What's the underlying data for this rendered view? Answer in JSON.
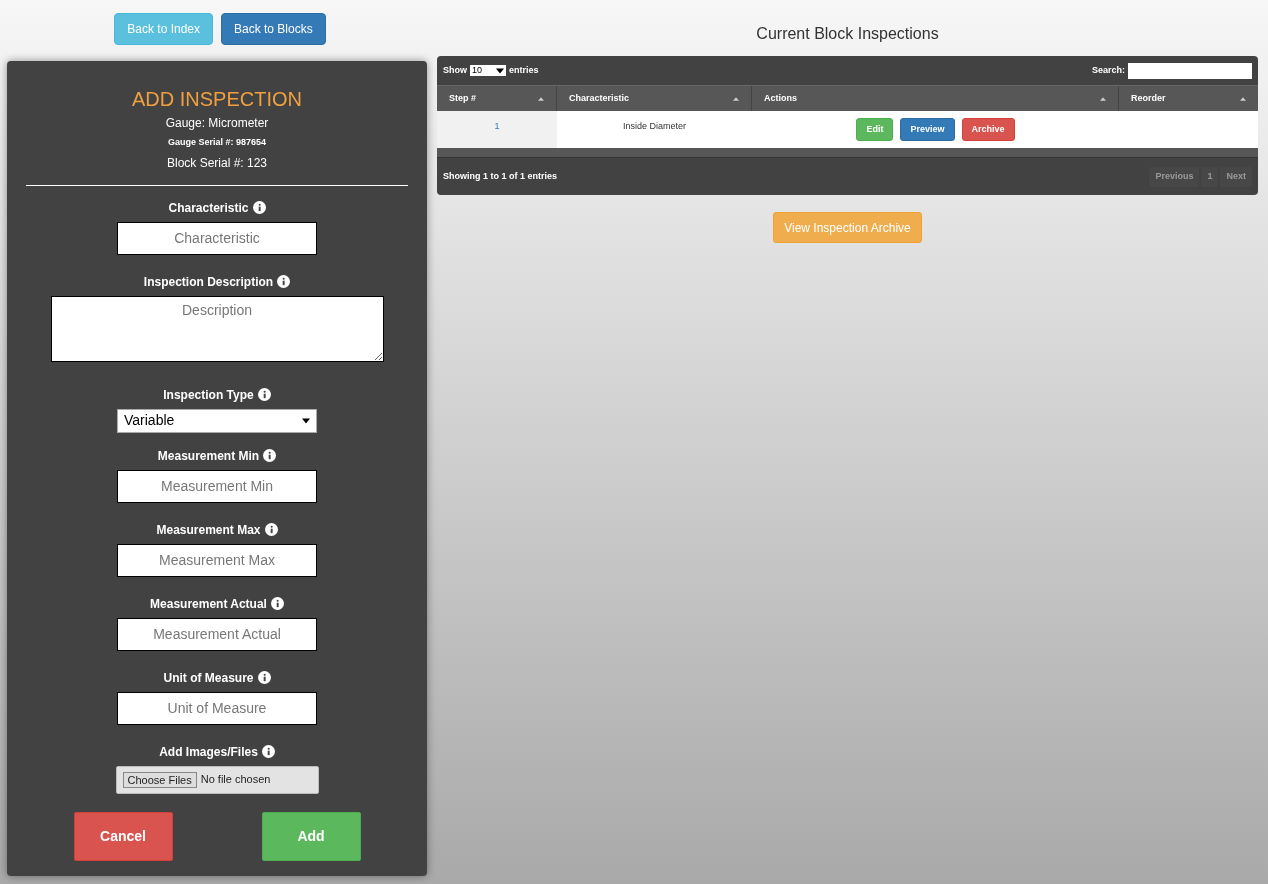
{
  "nav_buttons": [
    {
      "label": "Back to Index",
      "kind": "info"
    },
    {
      "label": "Back to Blocks",
      "kind": "primary"
    }
  ],
  "form": {
    "title": "ADD INSPECTION",
    "gauge": "Gauge: Micrometer",
    "gauge_serial": "Gauge Serial #: 987654",
    "block_serial": "Block Serial #: 123",
    "fields": [
      {
        "kind": "text",
        "label": "Characteristic",
        "placeholder": "Characteristic"
      },
      {
        "kind": "textarea",
        "label": "Inspection Description",
        "placeholder": "Description"
      },
      {
        "kind": "select",
        "label": "Inspection Type",
        "value": "Variable"
      },
      {
        "kind": "text",
        "label": "Measurement Min",
        "placeholder": "Measurement Min"
      },
      {
        "kind": "text",
        "label": "Measurement Max",
        "placeholder": "Measurement Max"
      },
      {
        "kind": "text",
        "label": "Measurement Actual",
        "placeholder": "Measurement Actual"
      },
      {
        "kind": "text",
        "label": "Unit of Measure",
        "placeholder": "Unit of Measure"
      },
      {
        "kind": "file",
        "label": "Add Images/Files",
        "button": "Choose Files",
        "value": "No file chosen"
      }
    ],
    "buttons": [
      {
        "label": "Cancel",
        "kind": "danger"
      },
      {
        "label": "Add",
        "kind": "success"
      }
    ]
  },
  "table_title": "Current Block Inspections",
  "table": {
    "show_label": "Show",
    "page_size": "10",
    "entries_label": "entries",
    "search_label": "Search:",
    "columns": [
      "Step #",
      "Characteristic",
      "Actions",
      "Reorder"
    ],
    "rows": [
      {
        "step": "1",
        "characteristic": "Inside Diameter",
        "actions": [
          {
            "label": "Edit",
            "kind": "success"
          },
          {
            "label": "Preview",
            "kind": "primary"
          },
          {
            "label": "Archive",
            "kind": "danger"
          }
        ]
      }
    ],
    "info": "Showing **1** to **1** of **1** entries",
    "pagination": [
      {
        "label": "Previous",
        "disabled": true
      },
      {
        "label": "1",
        "disabled": true
      },
      {
        "label": "Next",
        "disabled": true
      }
    ]
  },
  "archive_button": {
    "label": "View Inspection Archive",
    "kind": "warning"
  }
}
